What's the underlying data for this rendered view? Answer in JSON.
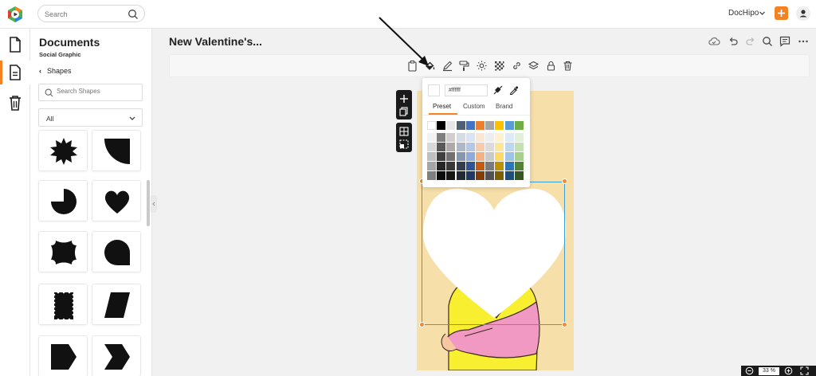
{
  "topbar": {
    "search_placeholder": "Search",
    "brand": "DocHipo",
    "logo_icon": "dochipo-logo-icon",
    "accent_color": "#f58220"
  },
  "rail": {
    "items": [
      {
        "icon": "document-icon"
      },
      {
        "icon": "my-documents-icon",
        "active": true
      },
      {
        "icon": "trash-icon"
      }
    ]
  },
  "panel": {
    "title": "Documents",
    "subtitle": "Social Graphic",
    "back_label": "Shapes",
    "search_placeholder": "Search Shapes",
    "filter_value": "All",
    "shapes": [
      "starburst-shape",
      "quarter-circle-shape",
      "pie-shape",
      "heart-shape",
      "plaque-shape",
      "speech-drop-shape",
      "stamp-shape",
      "parallelogram-shape",
      "pentagon-arrow-shape",
      "chevron-shape"
    ]
  },
  "editor": {
    "doc_title": "New Valentine's...",
    "toolbar_icons": [
      "clipboard-icon",
      "fill-color-icon",
      "pen-icon",
      "paint-roller-icon",
      "brightness-icon",
      "transparency-icon",
      "link-icon",
      "layers-icon",
      "lock-icon",
      "delete-icon"
    ],
    "right_icons": [
      "cloud-save-icon",
      "undo-icon",
      "redo-icon",
      "search-icon",
      "comment-icon",
      "more-icon"
    ]
  },
  "picker": {
    "hex": "#ffffff",
    "tabs": [
      "Preset",
      "Custom",
      "Brand"
    ],
    "active_tab": "Preset",
    "top_row": [
      "#ffffff",
      "#000000",
      "#e6e6e6",
      "#4f6075",
      "#4472c4",
      "#ed7d31",
      "#a5a5a5",
      "#ffc000",
      "#5b9bd5",
      "#70ad47"
    ],
    "shade_rows": [
      [
        "#f2f2f2",
        "#7f7f7f",
        "#d0cece",
        "#d6dce4",
        "#dae3f3",
        "#fbe5d5",
        "#ededed",
        "#fff2cc",
        "#deebf6",
        "#e2efd9"
      ],
      [
        "#d8d8d8",
        "#595959",
        "#aeaaaa",
        "#adb9ca",
        "#b4c7e7",
        "#f7cbac",
        "#dbdbdb",
        "#fee599",
        "#bdd7ee",
        "#c5e0b3"
      ],
      [
        "#bfbfbf",
        "#3f3f3f",
        "#757070",
        "#8496b0",
        "#8faadc",
        "#f4b183",
        "#c9c9c9",
        "#ffd965",
        "#9dc3e6",
        "#a8d08d"
      ],
      [
        "#a5a5a5",
        "#262626",
        "#3a3838",
        "#333f4f",
        "#2f5496",
        "#c55a11",
        "#7b7b7b",
        "#bf9000",
        "#2e75b5",
        "#538135"
      ],
      [
        "#7f7f7f",
        "#0c0c0c",
        "#171616",
        "#222a35",
        "#203864",
        "#843c0b",
        "#525252",
        "#7f6000",
        "#1e4e79",
        "#375623"
      ]
    ]
  },
  "zoom": {
    "value": "33 %"
  }
}
